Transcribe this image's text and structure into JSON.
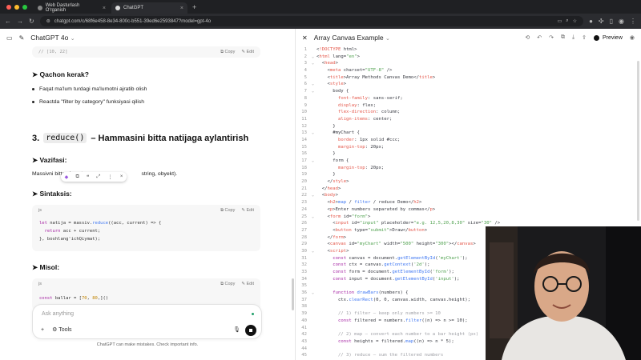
{
  "browser": {
    "tabs": [
      {
        "title": "Web Dasturlash O'rganish"
      },
      {
        "title": "ChatGPT"
      }
    ],
    "url": "chatgpt.com/c/68f6e458-8e34-800c-b551-39ed6e2593847?model=gpt-4o"
  },
  "chat": {
    "model_label": "ChatGPT 4o",
    "code1_line": "// [10, 22]",
    "copy_label": "Copy",
    "edit_label": "Edit",
    "qachon_heading": "➤ Qachon kerak?",
    "bullets": [
      "Faqat ma'lum turdagi ma'lumotni ajratib olish",
      "Reactda \"filter by category\" funksiyasi qilish"
    ],
    "section_number": "3.",
    "section_code": "reduce()",
    "section_title": "– Hammasini bitta natijaga aylantirish",
    "vazifasi_heading": "➤ Vazifasi:",
    "vazifasi_text": "Massivni bitta qiymatga",
    "vazifasi_tail": "string, obyekt).",
    "sintaksis_heading": "➤ Sintaksis:",
    "code2_lang": "js",
    "code2_lines": [
      "let natija = massiv.reduce((acc, current) => {",
      "  return acc + current;",
      "}, boshlang'ichQiymat);"
    ],
    "misol_heading": "➤ Misol:",
    "code3_lang": "js",
    "code3_line": "const ballar = [70, 80,]()",
    "composer_placeholder": "Ask anything",
    "tools_label": "Tools",
    "disclaimer": "ChatGPT can make mistakes. Check important info."
  },
  "canvas": {
    "title": "Array Canvas Example",
    "preview_label": "Preview",
    "lines": [
      {
        "n": "1",
        "t": "<!DOCTYPE html>"
      },
      {
        "n": "2",
        "t": "<html lang=\"en\">"
      },
      {
        "n": "3",
        "t": "  <head>"
      },
      {
        "n": "4",
        "t": "    <meta charset=\"UTF-8\" />"
      },
      {
        "n": "5",
        "t": "    <title>Array Methods Canvas Demo</title>"
      },
      {
        "n": "6",
        "t": "    <style>"
      },
      {
        "n": "7",
        "t": "      body {"
      },
      {
        "n": "8",
        "t": "        font-family: sans-serif;"
      },
      {
        "n": "9",
        "t": "        display: flex;"
      },
      {
        "n": "10",
        "t": "        flex-direction: column;"
      },
      {
        "n": "11",
        "t": "        align-items: center;"
      },
      {
        "n": "12",
        "t": "      }"
      },
      {
        "n": "13",
        "t": "      #myChart {"
      },
      {
        "n": "14",
        "t": "        border: 1px solid #ccc;"
      },
      {
        "n": "15",
        "t": "        margin-top: 20px;"
      },
      {
        "n": "16",
        "t": "      }"
      },
      {
        "n": "17",
        "t": "      form {"
      },
      {
        "n": "18",
        "t": "        margin-top: 20px;"
      },
      {
        "n": "19",
        "t": "      }"
      },
      {
        "n": "20",
        "t": "    </style>"
      },
      {
        "n": "21",
        "t": "  </head>"
      },
      {
        "n": "22",
        "t": "  <body>"
      },
      {
        "n": "23",
        "t": "    <h2>map / filter / reduce Demo</h2>"
      },
      {
        "n": "24",
        "t": "    <p>Enter numbers separated by commas</p>"
      },
      {
        "n": "25",
        "t": "    <form id=\"form\">"
      },
      {
        "n": "26",
        "t": "      <input id=\"input\" placeholder=\"e.g. 12,5,20,8,30\" size=\"30\" />"
      },
      {
        "n": "27",
        "t": "      <button type=\"submit\">Draw</button>"
      },
      {
        "n": "28",
        "t": "    </form>"
      },
      {
        "n": "29",
        "t": "    <canvas id=\"myChart\" width=\"500\" height=\"300\"></canvas>"
      },
      {
        "n": "30",
        "t": "    <script>"
      },
      {
        "n": "31",
        "t": "      const canvas = document.getElementById('myChart');"
      },
      {
        "n": "32",
        "t": "      const ctx = canvas.getContext('2d');"
      },
      {
        "n": "33",
        "t": "      const form = document.getElementById('form');"
      },
      {
        "n": "34",
        "t": "      const input = document.getElementById('input');"
      },
      {
        "n": "35",
        "t": ""
      },
      {
        "n": "36",
        "t": "      function drawBars(numbers) {"
      },
      {
        "n": "37",
        "t": "        ctx.clearRect(0, 0, canvas.width, canvas.height);"
      },
      {
        "n": "38",
        "t": ""
      },
      {
        "n": "39",
        "t": "        // 1) filter – keep only numbers >= 10"
      },
      {
        "n": "40",
        "t": "        const filtered = numbers.filter((n) => n >= 10);"
      },
      {
        "n": "41",
        "t": ""
      },
      {
        "n": "42",
        "t": "        // 2) map – convert each number to a bar height (px)"
      },
      {
        "n": "43",
        "t": "        const heights = filtered.map((n) => n * 5);"
      },
      {
        "n": "44",
        "t": ""
      },
      {
        "n": "45",
        "t": "        // 3) reduce – sum the filtered numbers"
      }
    ]
  },
  "colors": {
    "dark_chrome": "#1f2023",
    "editor_bg": "#ffffff",
    "tag": "#e45649",
    "string": "#50a14f",
    "keyword": "#a626a4",
    "function": "#4078f2"
  }
}
